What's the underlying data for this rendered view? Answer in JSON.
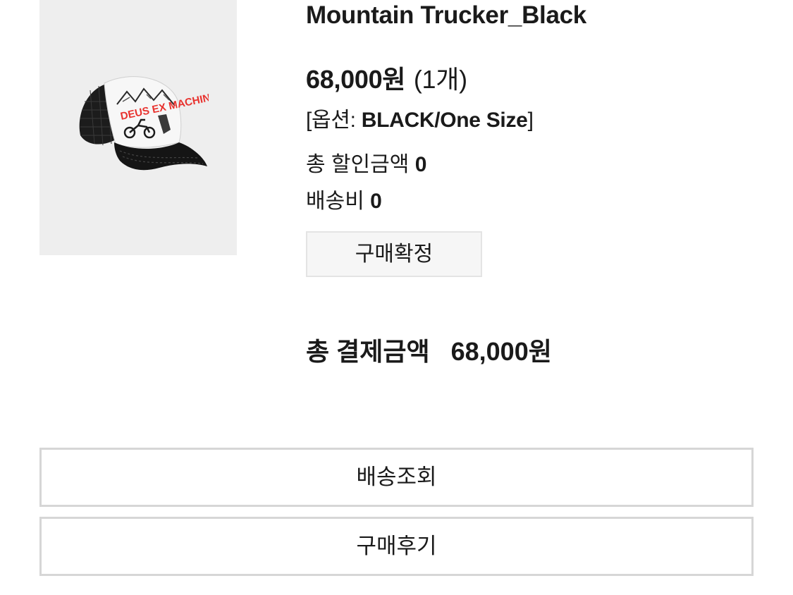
{
  "product": {
    "name": "Mountain Trucker_Black",
    "price": "68,000원",
    "quantity": "(1개)",
    "option_label": "[옵션:",
    "option_value": "BLACK/One Size",
    "option_close": "]",
    "image_print_text": "DEUS EX MACHINA"
  },
  "summary": {
    "discount_label": "총 할인금액",
    "discount_value": "0",
    "shipping_label": "배송비",
    "shipping_value": "0"
  },
  "actions": {
    "confirm_purchase": "구매확정",
    "track_delivery": "배송조회",
    "write_review": "구매후기"
  },
  "total": {
    "label": "총 결제금액",
    "amount": "68,000원"
  },
  "colors": {
    "text": "#1a1a1a",
    "image_bg": "#eeeeee",
    "confirm_bg": "#f6f6f6",
    "border": "#d6d6d6",
    "print_red": "#e8322e"
  }
}
